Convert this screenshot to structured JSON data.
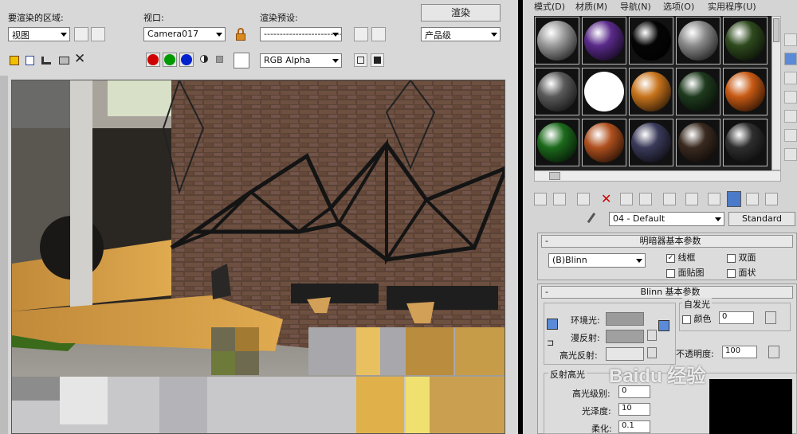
{
  "render_frame": {
    "area_label": "要渲染的区域:",
    "area_value": "视图",
    "viewport_label": "视口:",
    "viewport_value": "Camera017",
    "preset_label": "渲染预设:",
    "preset_value": "-------------------------",
    "render_button": "渲染",
    "quality_value": "产品级",
    "channel_value": "RGB Alpha",
    "colors": {
      "red": "#d00000",
      "green": "#009a00",
      "blue": "#0022cc"
    }
  },
  "material_editor": {
    "menu": [
      "模式(D)",
      "材质(M)",
      "导航(N)",
      "选项(O)",
      "实用程序(U)"
    ],
    "material_name": "04 - Default",
    "material_type": "Standard",
    "shader_rollout_title": "明暗器基本参数",
    "shader_value": "(B)Blinn",
    "wire_label": "线框",
    "two_sided_label": "双面",
    "face_map_label": "面贴图",
    "faceted_label": "面状",
    "wire_checked": true,
    "blinn_rollout_title": "Blinn 基本参数",
    "self_illum_label": "自发光",
    "color_label": "颜色",
    "self_illum_value": "0",
    "ambient_label": "环境光:",
    "diffuse_label": "漫反射:",
    "specular_label": "高光反射:",
    "opacity_label": "不透明度:",
    "opacity_value": "100",
    "specular_highlights_label": "反射高光",
    "specular_level_label": "高光级别:",
    "specular_level_value": "0",
    "glossiness_label": "光泽度:",
    "glossiness_value": "10",
    "soften_label": "柔化:",
    "soften_value": "0.1",
    "watermark": "Baidu 经验",
    "sample_slots": [
      {
        "name": "plain-grey",
        "color": "#9a9a9a"
      },
      {
        "name": "checker",
        "color": "#5a2a8a"
      },
      {
        "name": "black-glossy",
        "color": "#050505"
      },
      {
        "name": "grey",
        "color": "#8a8a8a"
      },
      {
        "name": "green-moss",
        "color": "#2f4a1e"
      },
      {
        "name": "dark-grey",
        "color": "#5a5a5a"
      },
      {
        "name": "white",
        "color": "#ffffff"
      },
      {
        "name": "orange",
        "color": "#c8741c"
      },
      {
        "name": "checker-dark",
        "color": "#1e3a1e"
      },
      {
        "name": "checker-orange",
        "color": "#c85a14"
      },
      {
        "name": "green",
        "color": "#1c6a1c"
      },
      {
        "name": "orange-rust",
        "color": "#b0501e"
      },
      {
        "name": "checker-dots",
        "color": "#3a3a5a"
      },
      {
        "name": "dark-brown",
        "color": "#3a2a20"
      },
      {
        "name": "dark",
        "color": "#2e2e2e"
      }
    ]
  }
}
